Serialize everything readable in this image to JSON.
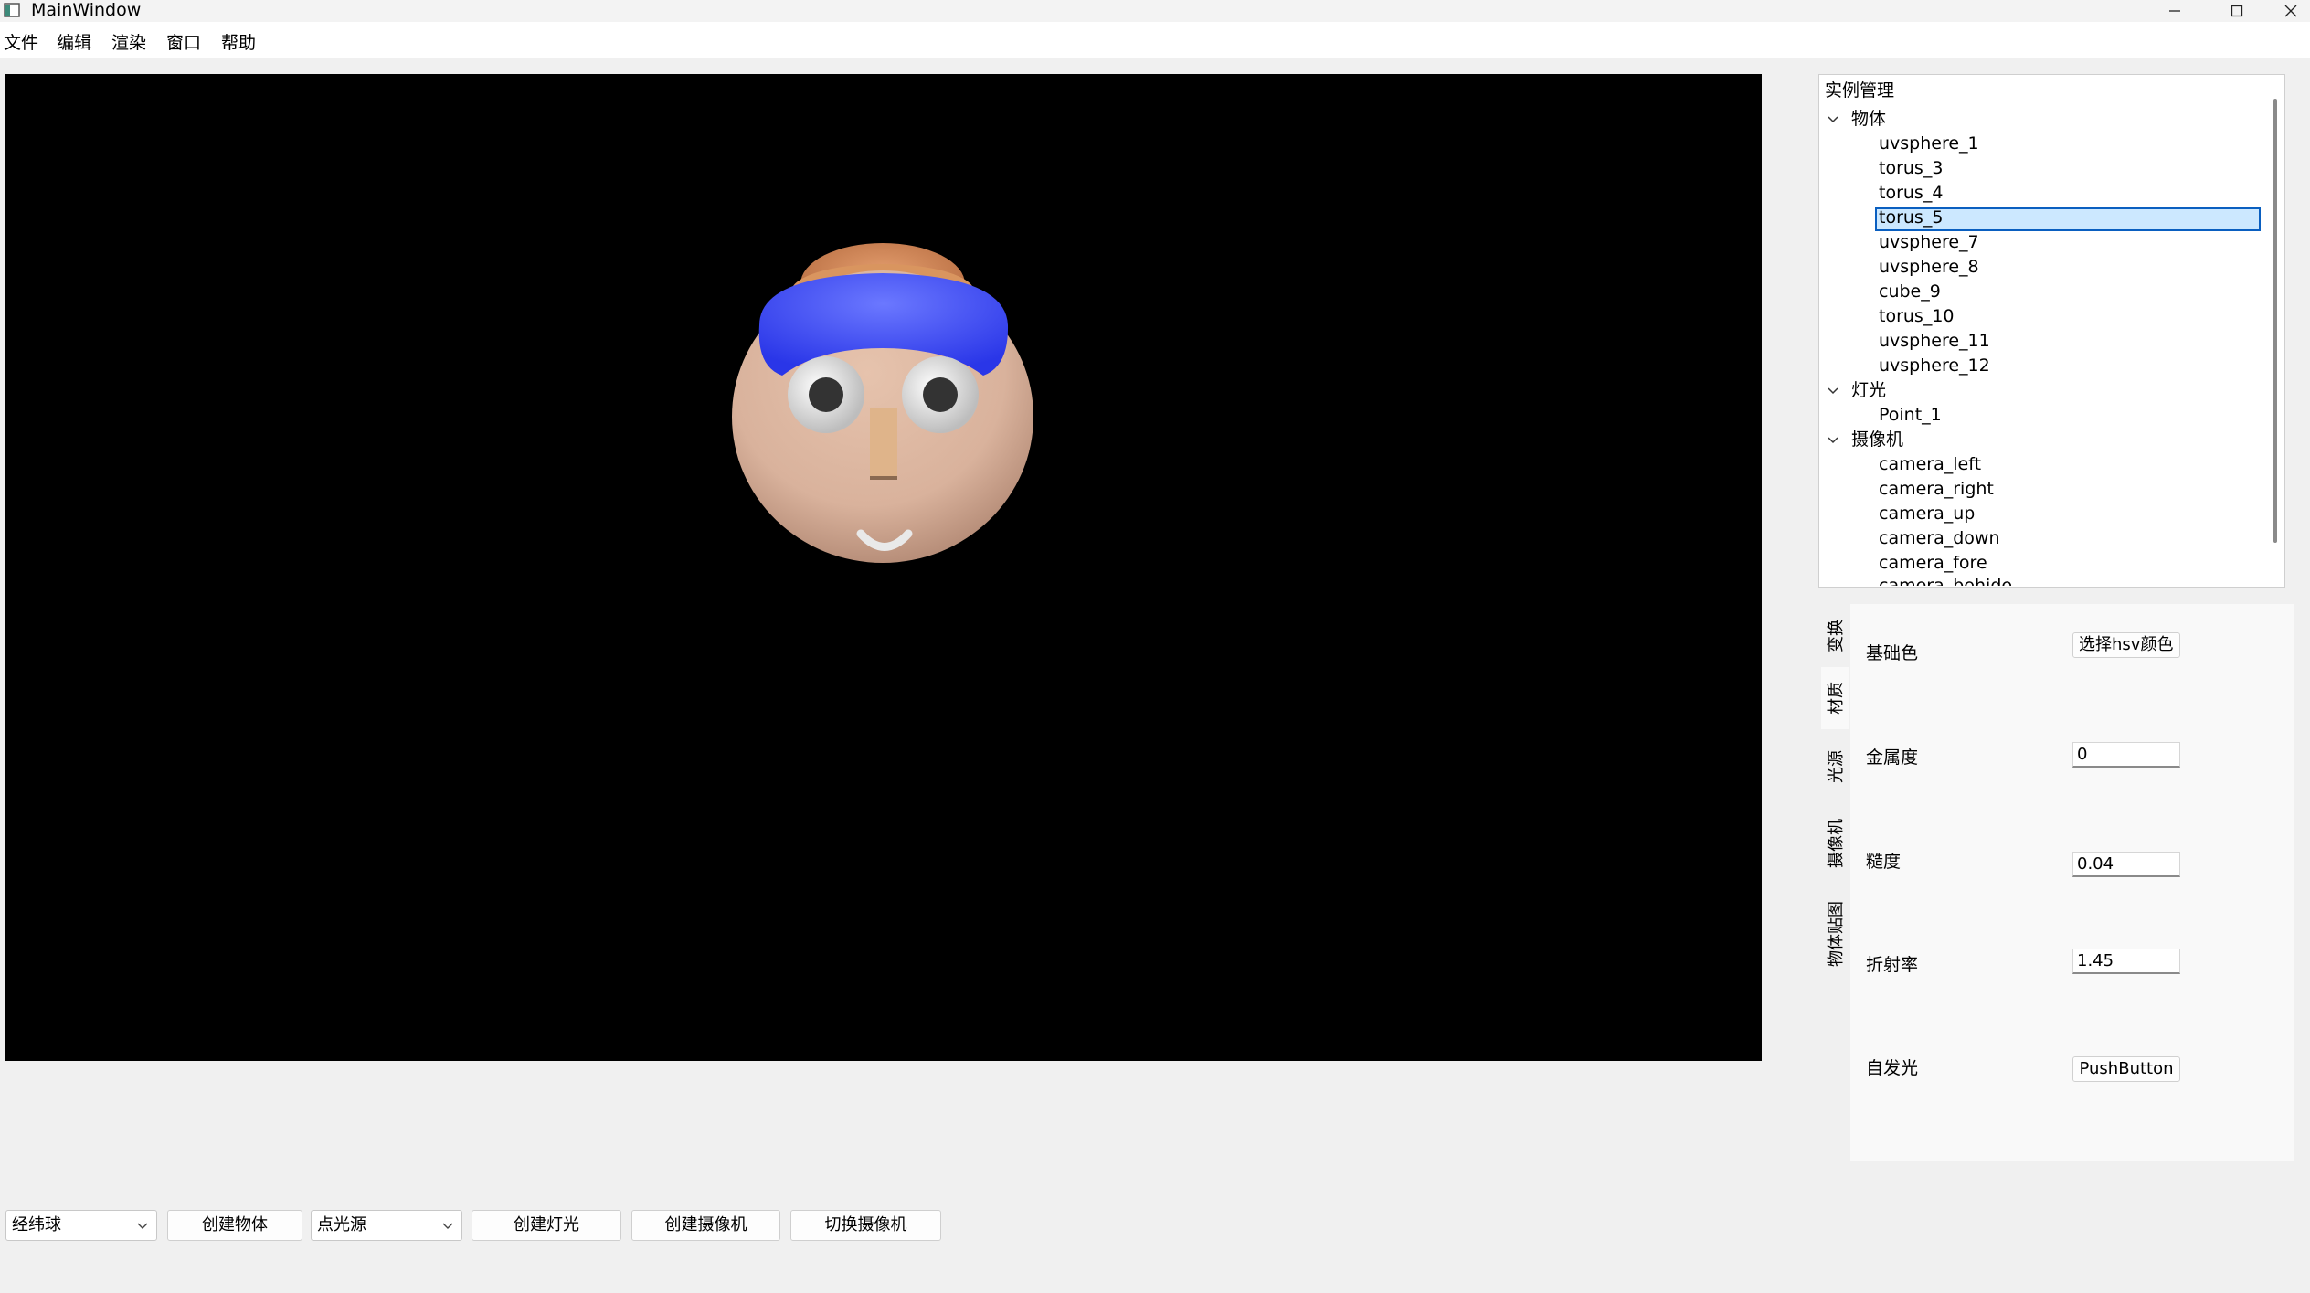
{
  "window": {
    "title": "MainWindow",
    "minimize_icon": "minimize-icon",
    "maximize_icon": "maximize-icon",
    "close_icon": "close-icon"
  },
  "menu": [
    "文件",
    "编辑",
    "渲染",
    "窗口",
    "帮助"
  ],
  "viewport": {
    "scene": "rendered 3D head",
    "colors": {
      "background": "#000000",
      "skin": "#d9b29c",
      "hat_band": "#4f5cff",
      "hat_top": "#d18a5a",
      "hat_mid": "#e0c080"
    }
  },
  "tree": {
    "header": "实例管理",
    "groups": [
      {
        "label": "物体",
        "items": [
          "uvsphere_1",
          "torus_3",
          "torus_4",
          "torus_5",
          "uvsphere_7",
          "uvsphere_8",
          "cube_9",
          "torus_10",
          "uvsphere_11",
          "uvsphere_12"
        ]
      },
      {
        "label": "灯光",
        "items": [
          "Point_1"
        ]
      },
      {
        "label": "摄像机",
        "items": [
          "camera_left",
          "camera_right",
          "camera_up",
          "camera_down",
          "camera_fore",
          "camera_behide"
        ]
      }
    ],
    "selected": "torus_5"
  },
  "tabs": [
    "变换",
    "材质",
    "光源",
    "摄像机",
    "物体贴图"
  ],
  "active_tab": "材质",
  "material": {
    "base_color_label": "基础色",
    "base_color_button": "选择hsv颜色",
    "metallic_label": "金属度",
    "metallic_value": "0",
    "roughness_label": "糙度",
    "roughness_value": "0.04",
    "ior_label": "折射率",
    "ior_value": "1.45",
    "emission_label": "自发光",
    "emission_button": "PushButton"
  },
  "toolbar": {
    "object_combo": "经纬球",
    "create_object": "创建物体",
    "light_combo": "点光源",
    "create_light": "创建灯光",
    "create_camera": "创建摄像机",
    "switch_camera": "切换摄像机"
  }
}
